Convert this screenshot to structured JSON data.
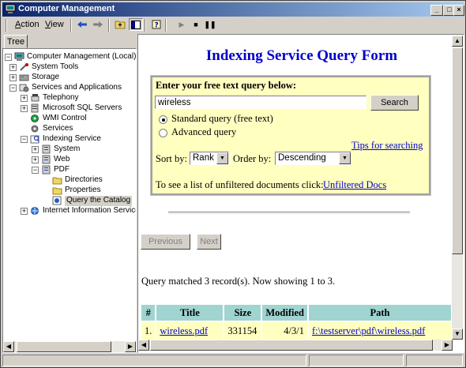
{
  "window": {
    "title": "Computer Management"
  },
  "menu": {
    "action": "Action",
    "view": "View"
  },
  "tabs": {
    "tree": "Tree"
  },
  "tree": [
    {
      "label": "Computer Management (Local)",
      "exp": "minus"
    },
    {
      "label": "System Tools",
      "exp": "plus"
    },
    {
      "label": "Storage",
      "exp": "plus"
    },
    {
      "label": "Services and Applications",
      "exp": "minus"
    },
    {
      "label": "Telephony",
      "exp": "plus"
    },
    {
      "label": "Microsoft SQL Servers",
      "exp": "plus"
    },
    {
      "label": "WMI Control",
      "exp": ""
    },
    {
      "label": "Services",
      "exp": ""
    },
    {
      "label": "Indexing Service",
      "exp": "minus"
    },
    {
      "label": "System",
      "exp": "plus"
    },
    {
      "label": "Web",
      "exp": "plus"
    },
    {
      "label": "PDF",
      "exp": "minus"
    },
    {
      "label": "Directories",
      "exp": ""
    },
    {
      "label": "Properties",
      "exp": ""
    },
    {
      "label": "Query the Catalog",
      "exp": "",
      "selected": true
    },
    {
      "label": "Internet Information Service",
      "exp": "plus"
    }
  ],
  "form": {
    "title": "Indexing Service Query Form",
    "prompt": "Enter your free text query below:",
    "query_value": "wireless",
    "search_label": "Search",
    "standard_label": "Standard query (free text)",
    "advanced_label": "Advanced query",
    "tips_link": "Tips for searching",
    "sort_label": "Sort by:",
    "sort_value": "Rank",
    "order_label": "Order by:",
    "order_value": "Descending",
    "unfiltered_text": "To see a list of unfiltered documents click:",
    "unfiltered_link": "Unfiltered Docs"
  },
  "nav": {
    "previous": "Previous",
    "next": "Next"
  },
  "results": {
    "summary": "Query matched 3 record(s). Now showing 1 to 3.",
    "headers": [
      "#",
      "Title",
      "Size",
      "Modified",
      "Path"
    ],
    "rows": [
      {
        "num": "1.",
        "title": "wireless.pdf",
        "size": "331154",
        "modified": "4/3/1",
        "path": "f:\\testserver\\pdf\\wireless.pdf"
      }
    ]
  },
  "colors": {
    "titlebar_start": "#0a246a",
    "titlebar_end": "#a6caf0",
    "link": "#0000cc",
    "form_bg": "#ffffc0",
    "header_bg": "#a0d4d0"
  }
}
